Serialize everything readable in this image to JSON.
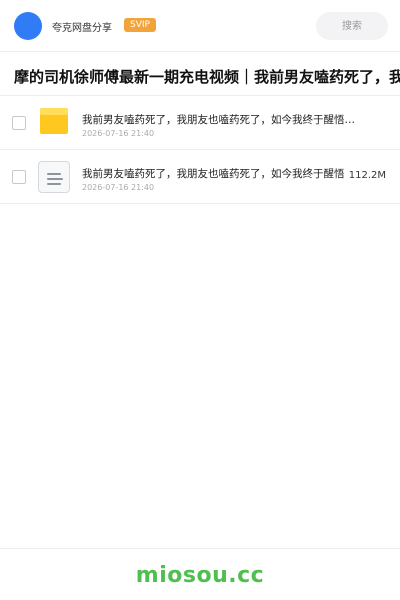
{
  "header": {
    "user_name": "夸克网盘分享",
    "badge": "SVIP",
    "search_placeholder": "搜索",
    "avatar_color": "#2f7cf6",
    "badge_color": "#f2a33a"
  },
  "share": {
    "title": "摩的司机徐师傅最新一期充电视频｜我前男友嗑药死了，我"
  },
  "files": [
    {
      "icon": "folder-icon",
      "name": "我前男友嗑药死了，我朋友也嗑药死了，如今我终于醒悟…",
      "time": "2026-07-16 21:40",
      "size": ""
    },
    {
      "icon": "document-icon",
      "name": "我前男友嗑药死了，我朋友也嗑药死了，如今我终于醒悟",
      "time": "2026-07-16 21:40",
      "size": "112.2M"
    }
  ],
  "footer": {
    "watermark": "miosou.cc",
    "watermark_color": "#4fbf4f"
  }
}
